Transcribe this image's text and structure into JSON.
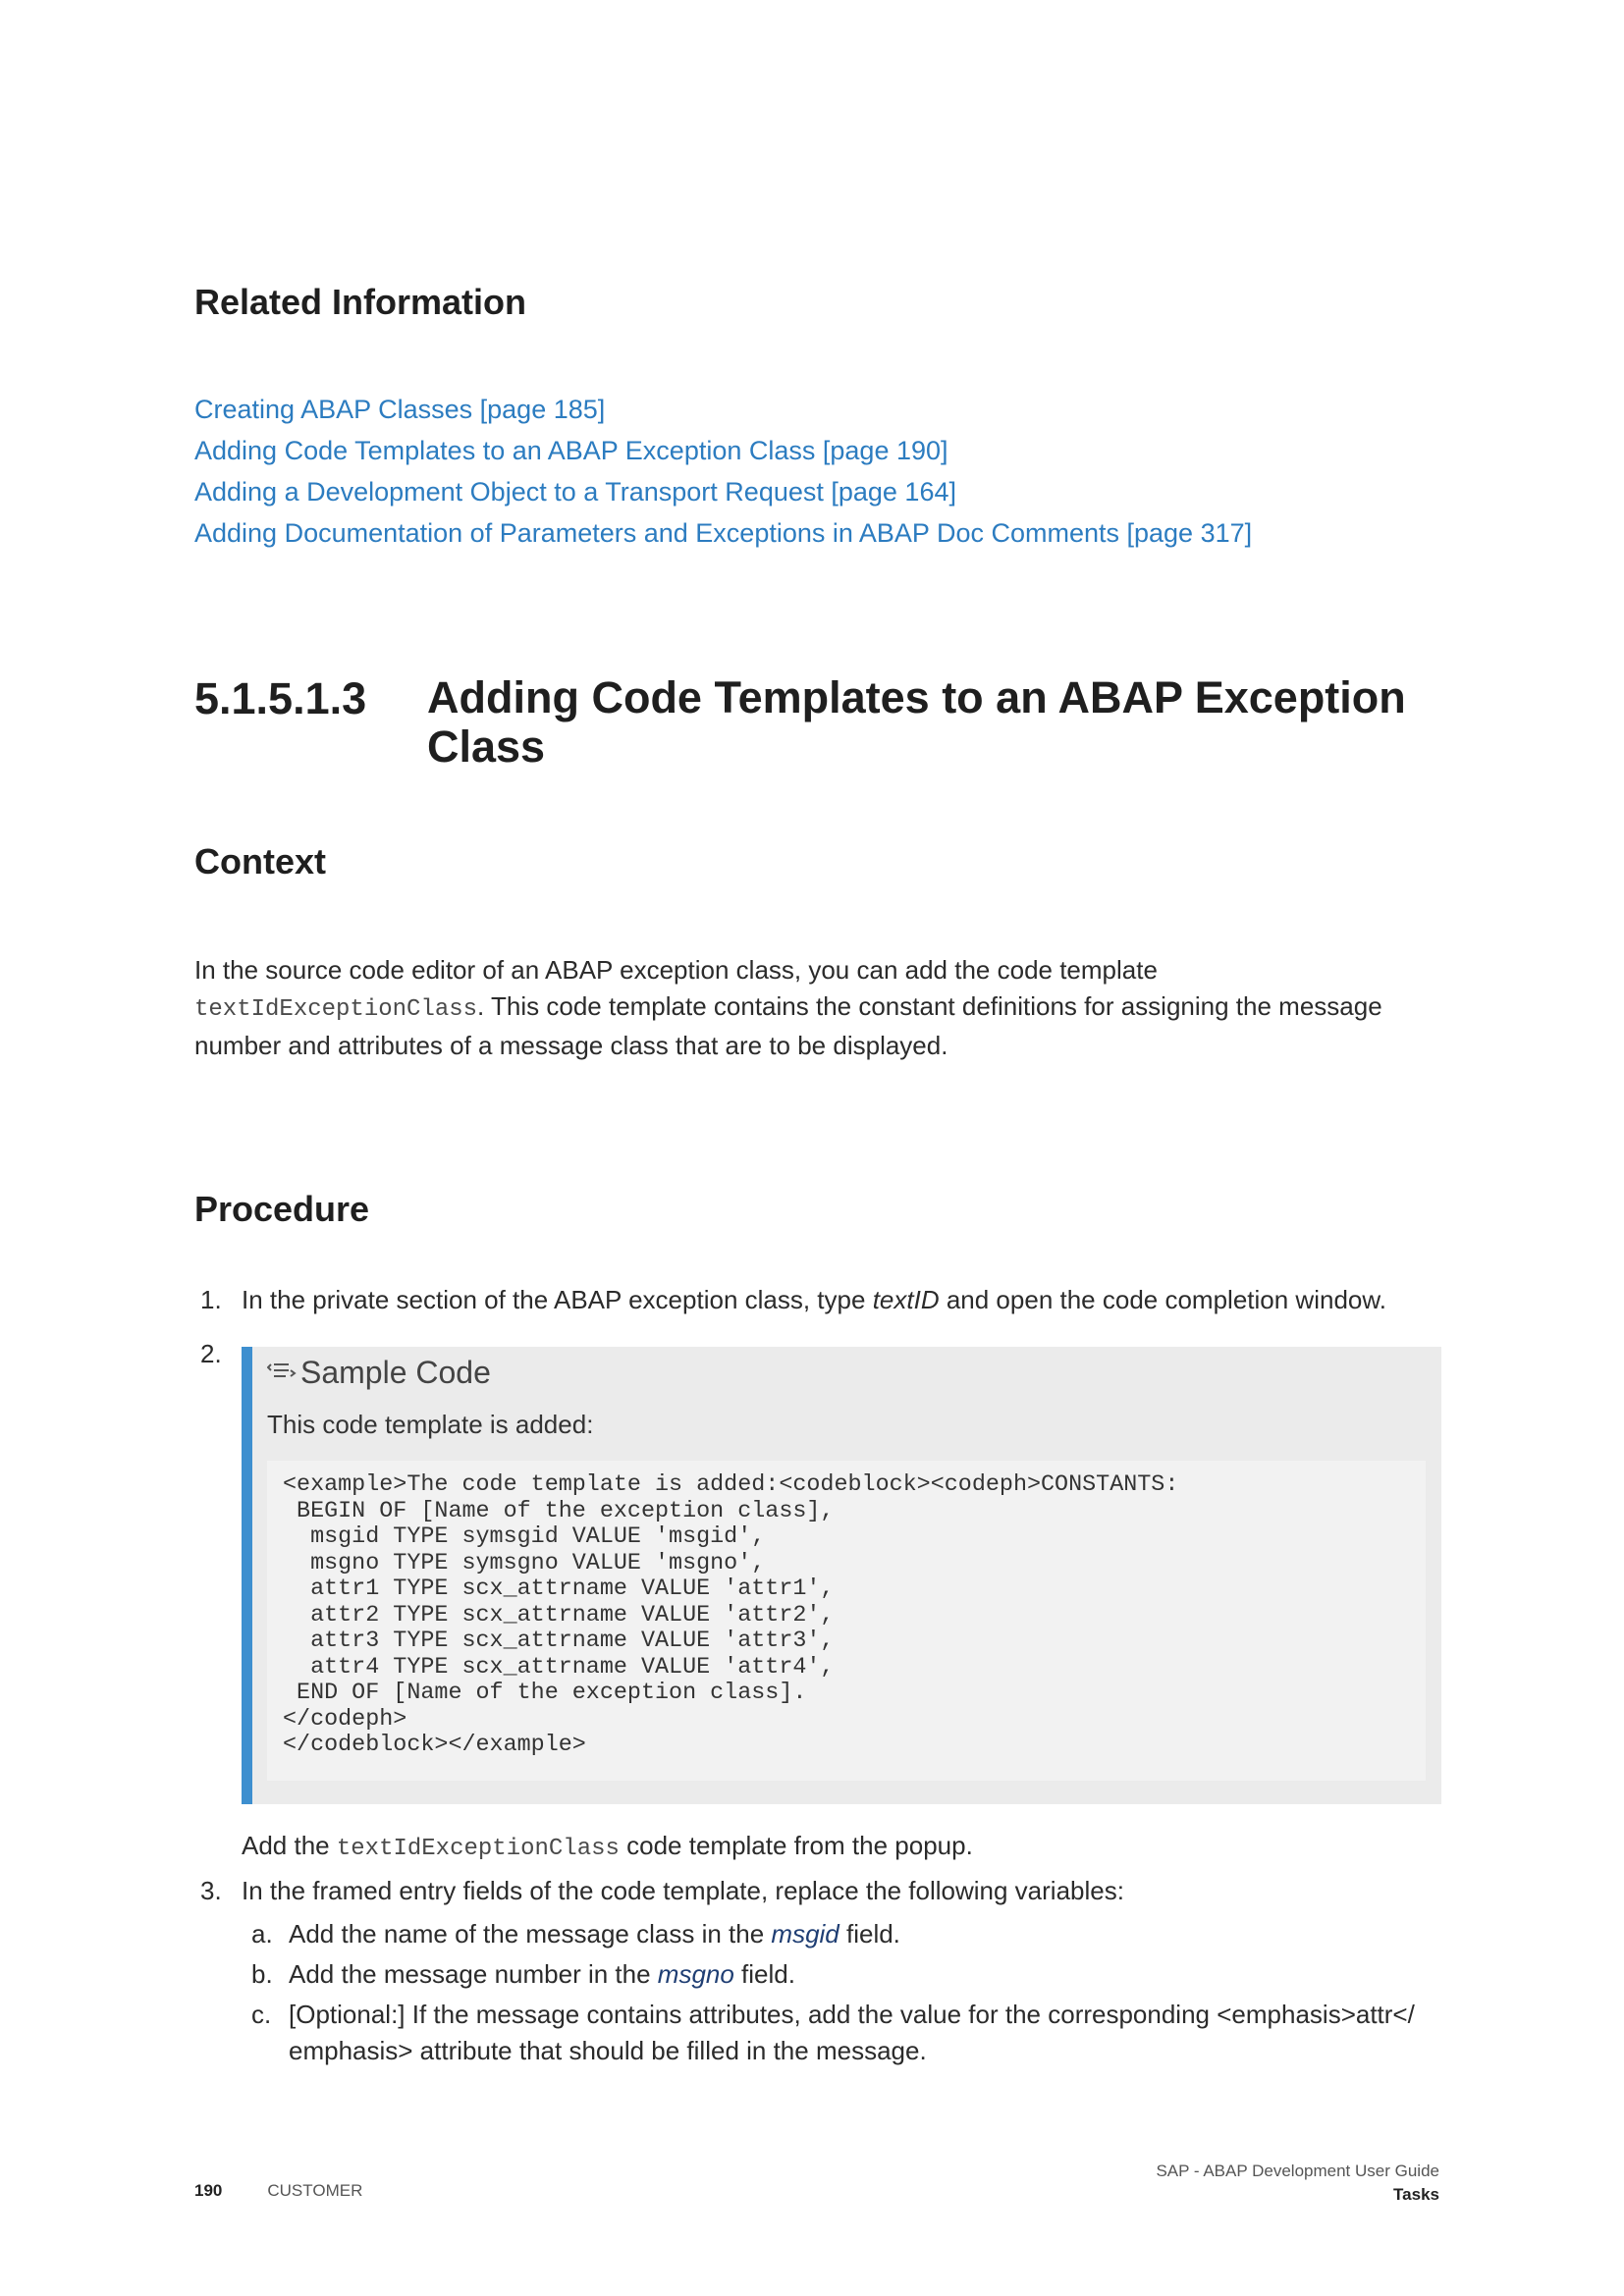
{
  "related": {
    "heading": "Related Information",
    "links": [
      "Creating ABAP Classes [page 185]",
      "Adding Code Templates to an ABAP Exception Class [page 190]",
      "Adding a Development Object to a Transport Request [page 164]",
      "Adding Documentation of Parameters and Exceptions in ABAP Doc Comments [page 317]"
    ]
  },
  "section": {
    "number": "5.1.5.1.3",
    "title": "Adding Code Templates to an ABAP Exception Class"
  },
  "context": {
    "heading": "Context",
    "text_before": "In the source code editor of an ABAP exception class, you can add the code template",
    "code_term": "textIdExceptionClass",
    "text_after": ". This code template contains the constant definitions for assigning the message number and attributes of a message class that are to be displayed."
  },
  "procedure": {
    "heading": "Procedure",
    "step1": {
      "num": "1.",
      "before": "In the private section of the ABAP exception class, type ",
      "term": "textID",
      "after": " and open the code completion window."
    },
    "step2": {
      "num": "2.",
      "sample_title": "Sample Code",
      "sample_desc": "This code template is added:",
      "code": "<example>The code template is added:<codeblock><codeph>CONSTANTS:\n BEGIN OF [Name of the exception class],\n  msgid TYPE symsgid VALUE 'msgid',\n  msgno TYPE symsgno VALUE 'msgno',\n  attr1 TYPE scx_attrname VALUE 'attr1',\n  attr2 TYPE scx_attrname VALUE 'attr2',\n  attr3 TYPE scx_attrname VALUE 'attr3',\n  attr4 TYPE scx_attrname VALUE 'attr4',\n END OF [Name of the exception class].\n</codeph>\n</codeblock></example>",
      "after_before": "Add the ",
      "after_code": "textIdExceptionClass",
      "after_after": " code template from the popup."
    },
    "step3": {
      "num": "3.",
      "text": "In the framed entry fields of the code template, replace the following variables:",
      "a": {
        "num": "a.",
        "before": "Add the name of the message class in the ",
        "var": "msgid",
        "after": " field."
      },
      "b": {
        "num": "b.",
        "before": "Add the message number in the ",
        "var": "msgno",
        "after": " field."
      },
      "c": {
        "num": "c.",
        "text": "[Optional:] If the message contains attributes, add the value for the corresponding <emphasis>attr</ emphasis> attribute that should be filled in the message."
      }
    }
  },
  "footer": {
    "page": "190",
    "label": "CUSTOMER",
    "doc_title": "SAP - ABAP Development User Guide",
    "section": "Tasks"
  },
  "colors": {
    "link": "#2c7cc0",
    "accent_bar": "#3e8fcf",
    "variable": "#1f3e73"
  }
}
